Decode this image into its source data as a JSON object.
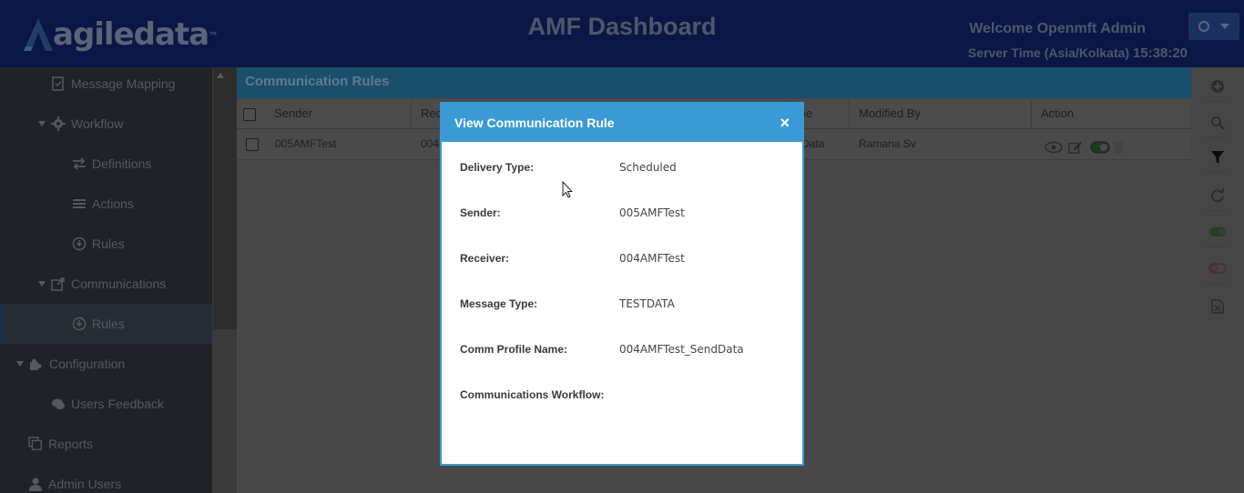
{
  "header": {
    "logo_text": "agiledata",
    "logo_tm": "™",
    "title": "AMF Dashboard",
    "welcome": "Welcome Openmft Admin",
    "server_time_label": "Server Time (Asia/Kolkata)",
    "server_time_value": "15:38:20"
  },
  "sidebar": {
    "items": [
      {
        "label": "Message Mapping",
        "icon": "mapping-icon"
      },
      {
        "label": "Workflow",
        "icon": "gear-icon"
      },
      {
        "label": "Definitions",
        "icon": "exchange-icon"
      },
      {
        "label": "Actions",
        "icon": "list-icon"
      },
      {
        "label": "Rules",
        "icon": "rules-icon"
      },
      {
        "label": "Communications",
        "icon": "share-icon"
      },
      {
        "label": "Rules",
        "icon": "rules-icon"
      },
      {
        "label": "Configuration",
        "icon": "puzzle-icon"
      },
      {
        "label": "Users Feedback",
        "icon": "chat-icon"
      },
      {
        "label": "Reports",
        "icon": "copy-icon"
      },
      {
        "label": "Admin Users",
        "icon": "user-icon"
      }
    ]
  },
  "panel": {
    "title": "Communication Rules",
    "columns": {
      "sender": "Sender",
      "receiver": "Rec",
      "me": "me",
      "modified_by": "Modified By",
      "action": "Action"
    },
    "rows": [
      {
        "sender": "005AMFTest",
        "receiver": "004",
        "me": "Data",
        "modified_by": "Ramana Sv"
      }
    ]
  },
  "modal": {
    "title": "View Communication Rule",
    "close": "×",
    "fields": [
      {
        "label": "Delivery Type:",
        "value": "Scheduled"
      },
      {
        "label": "Sender:",
        "value": "005AMFTest"
      },
      {
        "label": "Receiver:",
        "value": "004AMFTest"
      },
      {
        "label": "Message Type:",
        "value": "TESTDATA"
      },
      {
        "label": "Comm Profile Name:",
        "value": "004AMFTest_SendData"
      },
      {
        "label": "Communications Workflow:",
        "value": ""
      }
    ]
  },
  "colors": {
    "header_bg": "#0a1746",
    "modal_accent": "#3a9ad6",
    "sidebar_bg": "#1f2328"
  }
}
